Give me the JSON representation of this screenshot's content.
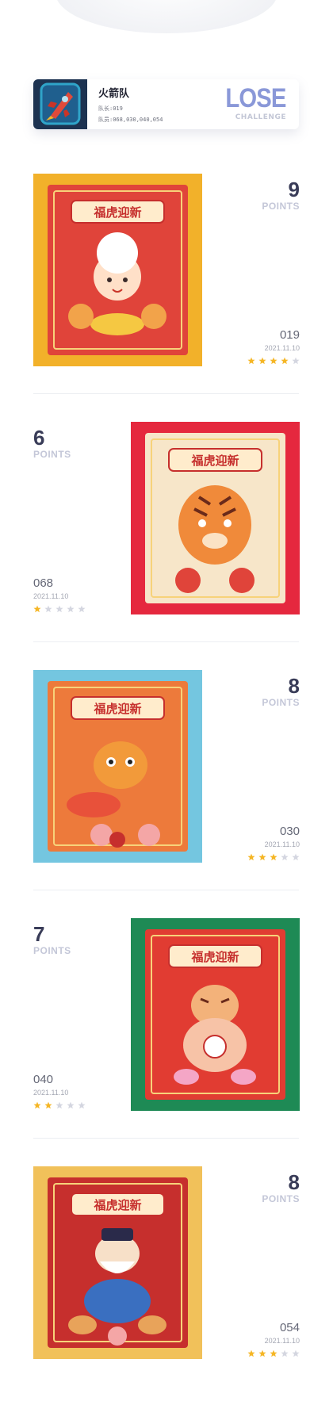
{
  "team": {
    "name": "火箭队",
    "captain": "队长:019",
    "members": "队员:068,030,040,054",
    "result": "LOSE",
    "result_sub": "CHALLENGE"
  },
  "points_label": "POINTS",
  "entries": [
    {
      "points": "9",
      "id": "019",
      "date": "2021.11.10",
      "stars": 4,
      "side": "left",
      "bg": "#f2b12a",
      "inner": "#e0443a",
      "banner": "福虎迎新",
      "theme": "girl"
    },
    {
      "points": "6",
      "id": "068",
      "date": "2021.11.10",
      "stars": 1,
      "side": "right",
      "bg": "#e5283e",
      "inner": "#f7e6c9",
      "banner": "福虎迎新",
      "theme": "tiger"
    },
    {
      "points": "8",
      "id": "030",
      "date": "2021.11.10",
      "stars": 3,
      "side": "left",
      "bg": "#74c6e0",
      "inner": "#ed7a3b",
      "banner": "福虎迎新",
      "theme": "fish"
    },
    {
      "points": "7",
      "id": "040",
      "date": "2021.11.10",
      "stars": 2,
      "side": "right",
      "bg": "#1e8a55",
      "inner": "#e13c32",
      "banner": "福虎迎新",
      "theme": "bag"
    },
    {
      "points": "8",
      "id": "054",
      "date": "2021.11.10",
      "stars": 3,
      "side": "left",
      "bg": "#f1c15a",
      "inner": "#c62f2d",
      "banner": "福虎迎新",
      "theme": "god"
    }
  ],
  "colors": {
    "star_on": "#f5b625",
    "star_off": "#d4d6e0",
    "accent": "#8a98d8"
  }
}
